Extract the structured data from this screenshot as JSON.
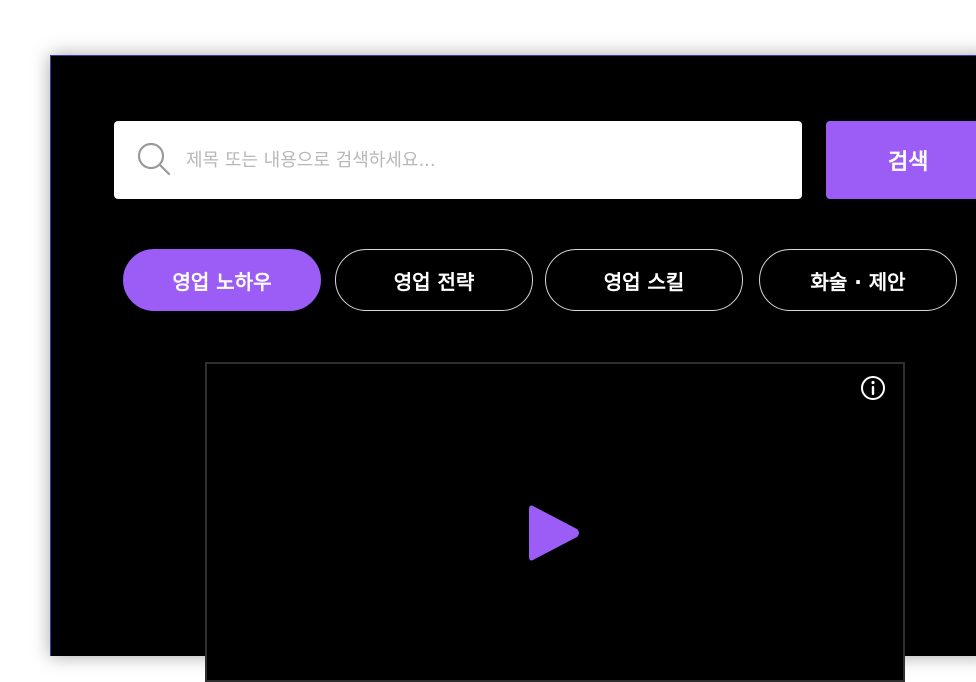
{
  "search": {
    "placeholder": "제목 또는 내용으로 검색하세요...",
    "value": "",
    "button_label": "검색"
  },
  "tabs": [
    {
      "label": "영업 노하우",
      "active": true
    },
    {
      "label": "영업 전략",
      "active": false
    },
    {
      "label": "영업 스킬",
      "active": false
    },
    {
      "label": "화술 · 제안",
      "active": false
    }
  ],
  "video": {
    "info_icon": "info-icon",
    "play_icon": "play-icon"
  },
  "colors": {
    "accent": "#9c5cf6",
    "background": "#000000",
    "tab_border": "#d7d7d7"
  }
}
